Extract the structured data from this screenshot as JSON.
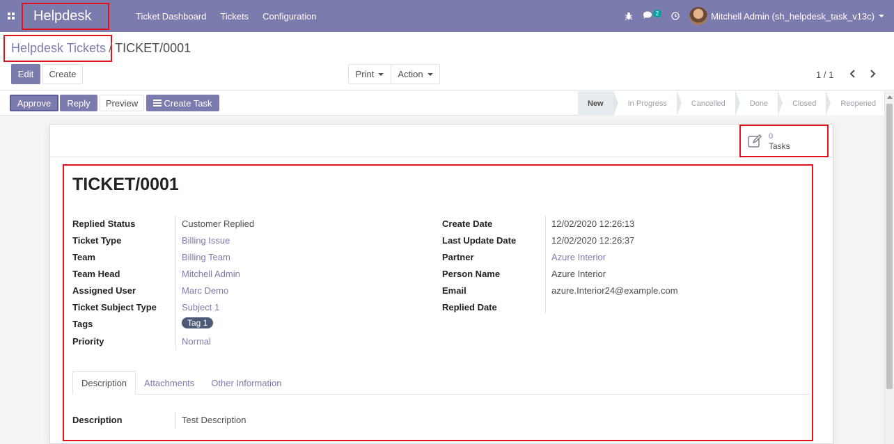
{
  "navbar": {
    "brand": "Helpdesk",
    "menu": [
      "Ticket Dashboard",
      "Tickets",
      "Configuration"
    ],
    "chat_badge": "2",
    "user": "Mitchell Admin (sh_helpdesk_task_v13c)"
  },
  "breadcrumb": {
    "parent": "Helpdesk Tickets",
    "separator": "/",
    "current": "TICKET/0001"
  },
  "toolbar": {
    "edit": "Edit",
    "create": "Create",
    "print": "Print",
    "action": "Action",
    "pager": "1 / 1"
  },
  "header_buttons": {
    "approve": "Approve",
    "reply": "Reply",
    "preview": "Preview",
    "create_task": "Create Task"
  },
  "stages": [
    "New",
    "In Progress",
    "Cancelled",
    "Done",
    "Closed",
    "Reopened"
  ],
  "smart_button": {
    "count": "0",
    "label": "Tasks"
  },
  "ticket": {
    "title": "TICKET/0001",
    "left": [
      {
        "label": "Replied Status",
        "value": "Customer Replied"
      },
      {
        "label": "Ticket Type",
        "value": "Billing Issue"
      },
      {
        "label": "Team",
        "value": "Billing Team"
      },
      {
        "label": "Team Head",
        "value": "Mitchell Admin"
      },
      {
        "label": "Assigned User",
        "value": "Marc Demo"
      },
      {
        "label": "Ticket Subject Type",
        "value": "Subject 1"
      },
      {
        "label": "Tags",
        "value": "Tag 1"
      },
      {
        "label": "Priority",
        "value": "Normal"
      }
    ],
    "right": [
      {
        "label": "Create Date",
        "value": "12/02/2020 12:26:13"
      },
      {
        "label": "Last Update Date",
        "value": "12/02/2020 12:26:37"
      },
      {
        "label": "Partner",
        "value": "Azure Interior"
      },
      {
        "label": "Person Name",
        "value": "Azure Interior"
      },
      {
        "label": "Email",
        "value": "azure.Interior24@example.com"
      },
      {
        "label": "Replied Date",
        "value": ""
      }
    ]
  },
  "tabs": [
    "Description",
    "Attachments",
    "Other Information"
  ],
  "description": {
    "label": "Description",
    "value": "Test Description"
  },
  "colors": {
    "primary": "#7c7bad",
    "highlight_border": "#e0131d",
    "tag": "#4d5a75",
    "badge": "#00a09d"
  }
}
